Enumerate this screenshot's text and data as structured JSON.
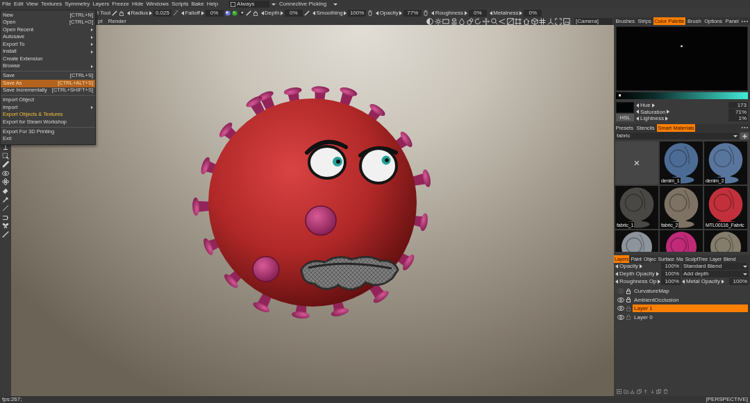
{
  "menu_bar": {
    "items": [
      "File",
      "Edit",
      "View",
      "Textures",
      "Symmetry",
      "Layers",
      "Freeze",
      "Hide",
      "Windows",
      "Scripts",
      "Bake",
      "Help"
    ],
    "always_toggle": {
      "label": "Always",
      "checked": false
    },
    "picking_dropdown": {
      "label": "Connective Picking"
    }
  },
  "tool_options": {
    "tool": "t Tool",
    "params": [
      {
        "label": "Radius",
        "value": "0.025"
      },
      {
        "label": "Falloff",
        "value": "0%"
      },
      {
        "label": "Depth",
        "value": "0%"
      },
      {
        "label": "Smoothing",
        "value": "100%"
      },
      {
        "label": "Opacity",
        "value": "77%"
      },
      {
        "label": "Roughness",
        "value": "0%"
      },
      {
        "label": "Metalness",
        "value": "0%"
      }
    ]
  },
  "view_bar": {
    "tabs": [
      "pt",
      "Render"
    ],
    "camera": "[Camera]"
  },
  "file_menu": {
    "groups": [
      [
        {
          "label": "New",
          "shortcut": "[CTRL+N]",
          "submenu": false,
          "selected": false,
          "emphasized": false
        },
        {
          "label": "Open",
          "shortcut": "[CTRL+O]",
          "submenu": false,
          "selected": false,
          "emphasized": false
        },
        {
          "label": "Open Recent",
          "submenu": true,
          "selected": false,
          "emphasized": false
        },
        {
          "label": "Autosave",
          "submenu": true,
          "selected": false,
          "emphasized": false
        },
        {
          "label": "Export To",
          "submenu": true,
          "selected": false,
          "emphasized": false
        },
        {
          "label": "Install",
          "submenu": true,
          "selected": false,
          "emphasized": false
        },
        {
          "label": "Create Extension",
          "submenu": false,
          "selected": false,
          "emphasized": false
        },
        {
          "label": "Browse",
          "submenu": true,
          "selected": false,
          "emphasized": false
        }
      ],
      [
        {
          "label": "Save",
          "shortcut": "[CTRL+S]",
          "submenu": false,
          "selected": false,
          "emphasized": false
        },
        {
          "label": "Save As",
          "shortcut": "[CTRL+ALT+S]",
          "submenu": false,
          "selected": true,
          "emphasized": false
        },
        {
          "label": "Save Incrementally",
          "shortcut": "[CTRL+SHIFT+S]",
          "submenu": false,
          "selected": false,
          "emphasized": false
        }
      ],
      [
        {
          "label": "Import Object",
          "submenu": false,
          "selected": false,
          "emphasized": false
        },
        {
          "label": "Import",
          "submenu": true,
          "selected": false,
          "emphasized": false
        },
        {
          "label": "Export Objects & Textures",
          "submenu": false,
          "selected": false,
          "emphasized": true
        },
        {
          "label": "Export for Steam Workshop",
          "submenu": false,
          "selected": false,
          "emphasized": false
        }
      ],
      [
        {
          "label": "Export For 3D Printing",
          "submenu": false,
          "selected": false,
          "emphasized": false
        },
        {
          "label": "Exit",
          "submenu": false,
          "selected": false,
          "emphasized": false
        }
      ]
    ]
  },
  "color_panel": {
    "tabs": [
      {
        "label": "Brushes",
        "selected": false
      },
      {
        "label": "Strips",
        "selected": false
      },
      {
        "label": "Color Palette",
        "selected": true
      },
      {
        "label": "Brush",
        "selected": false
      },
      {
        "label": "Options",
        "selected": false
      },
      {
        "label": "Panel",
        "selected": false
      }
    ],
    "lightness_slider": {
      "level": 0.01
    },
    "mode_button": "HSL",
    "values": [
      {
        "label": "Hue",
        "value": "173"
      },
      {
        "label": "Saturation",
        "value": "71%"
      },
      {
        "label": "Lightness",
        "value": "1%"
      }
    ]
  },
  "materials_panel": {
    "tabs": [
      {
        "label": "Presets",
        "selected": false
      },
      {
        "label": "Stencils",
        "selected": false
      },
      {
        "label": "Smart Materials",
        "selected": true
      }
    ],
    "filter": "fabric",
    "items": [
      {
        "kind": "clear",
        "label": "×"
      },
      {
        "kind": "sphere",
        "label": "denim_1",
        "color": "#4d6c95"
      },
      {
        "kind": "sphere",
        "label": "denim_2",
        "color": "#58769d"
      },
      {
        "kind": "sphere",
        "label": "fabric_1",
        "color": "#4a4844"
      },
      {
        "kind": "sphere",
        "label": "fabric_2",
        "color": "#7d7264"
      },
      {
        "kind": "sphere",
        "label": "MTL00116_Fabric",
        "color": "#c2313b"
      },
      {
        "kind": "sphere",
        "color": "#8e949c"
      },
      {
        "kind": "sphere",
        "color": "#c02a78"
      },
      {
        "kind": "sphere",
        "color": "#857d6c"
      }
    ]
  },
  "layers_panel": {
    "tabs": [
      {
        "label": "Layers",
        "selected": true
      },
      {
        "label": "Paint",
        "selected": false
      },
      {
        "label": "Objec",
        "selected": false
      },
      {
        "label": "Surface",
        "selected": false
      },
      {
        "label": "Ma",
        "selected": false
      },
      {
        "label": "SculptTree",
        "selected": false
      },
      {
        "label": "Layer",
        "selected": false
      },
      {
        "label": "Blend",
        "selected": false
      }
    ],
    "properties": [
      {
        "kind": "blend",
        "label": "Opacity",
        "value": "100%",
        "mode": "Standard Blend"
      },
      {
        "kind": "blend",
        "label": "Depth Opacity",
        "value": "100%",
        "mode": "Add depth"
      },
      {
        "kind": "pair",
        "label": "Roughness Op",
        "value": "100%",
        "label_2": "Metal Opacity",
        "value_2": "100%"
      }
    ],
    "layers": [
      {
        "name": "CurvatureMap",
        "visible": false,
        "locked": true,
        "selected": false
      },
      {
        "name": "AmbientOcclusion",
        "visible": true,
        "locked": true,
        "selected": false
      },
      {
        "name": "Layer 1",
        "visible": true,
        "locked": false,
        "selected": true
      },
      {
        "name": "Layer 0",
        "visible": true,
        "locked": false,
        "selected": false
      }
    ]
  },
  "status_bar": {
    "fps": "fps:267;",
    "view": "[PERSPECTIVE]"
  }
}
